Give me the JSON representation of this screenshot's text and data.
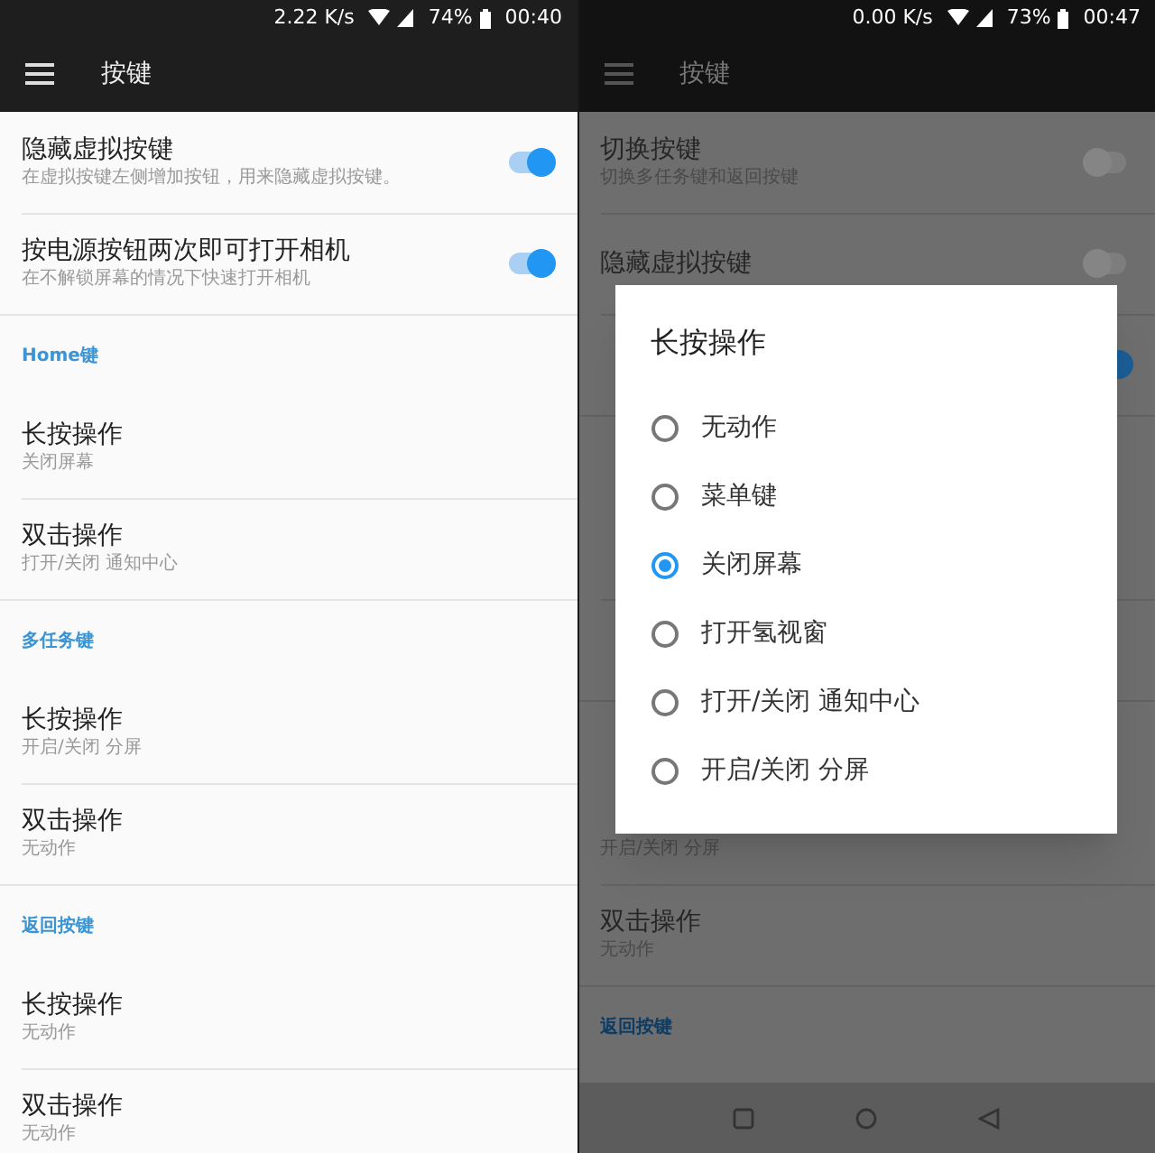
{
  "panels": [
    {
      "dimmed": false,
      "status_bar": {
        "speed": "2.22 K/s",
        "battery": "74%",
        "time": "00:40"
      },
      "app_bar": {
        "title": "按键"
      },
      "items": [
        {
          "kind": "setting",
          "title": "隐藏虚拟按键",
          "subtitle": "在虚拟按键左侧增加按钮，用来隐藏虚拟按键。",
          "toggle": {
            "on": true
          }
        },
        {
          "kind": "setting",
          "title": "按电源按钮两次即可打开相机",
          "subtitle": "在不解锁屏幕的情况下快速打开相机",
          "toggle": {
            "on": true
          }
        },
        {
          "kind": "section",
          "label": "Home键"
        },
        {
          "kind": "setting",
          "title": "长按操作",
          "subtitle": "关闭屏幕"
        },
        {
          "kind": "setting",
          "title": "双击操作",
          "subtitle": "打开/关闭 通知中心"
        },
        {
          "kind": "section",
          "label": "多任务键"
        },
        {
          "kind": "setting",
          "title": "长按操作",
          "subtitle": "开启/关闭 分屏"
        },
        {
          "kind": "setting",
          "title": "双击操作",
          "subtitle": "无动作"
        },
        {
          "kind": "section",
          "label": "返回按键"
        },
        {
          "kind": "setting",
          "title": "长按操作",
          "subtitle": "无动作"
        },
        {
          "kind": "setting",
          "title": "双击操作",
          "subtitle": "无动作"
        }
      ],
      "nav_bar": false
    },
    {
      "dimmed": true,
      "status_bar": {
        "speed": "0.00 K/s",
        "battery": "73%",
        "time": "00:47"
      },
      "app_bar": {
        "title": "按键"
      },
      "items": [
        {
          "kind": "setting",
          "title": "切换按键",
          "subtitle": "切换多任务键和返回按键",
          "toggle": {
            "on": false
          }
        },
        {
          "kind": "setting",
          "title": "隐藏虚拟按键",
          "toggle": {
            "on": false
          }
        },
        {
          "kind": "setting",
          "toggle": {
            "on": true
          }
        },
        {
          "kind": "section"
        },
        {
          "kind": "setting"
        },
        {
          "kind": "setting"
        },
        {
          "kind": "section"
        },
        {
          "kind": "setting",
          "subtitle": "开启/关闭 分屏"
        },
        {
          "kind": "setting",
          "title": "双击操作",
          "subtitle": "无动作"
        },
        {
          "kind": "section",
          "label": "返回按键"
        }
      ],
      "nav_bar": true,
      "dialog": {
        "title": "长按操作",
        "options": [
          {
            "label": "无动作",
            "selected": false
          },
          {
            "label": "菜单键",
            "selected": false
          },
          {
            "label": "关闭屏幕",
            "selected": true
          },
          {
            "label": "打开氢视窗",
            "selected": false
          },
          {
            "label": "打开/关闭 通知中心",
            "selected": false
          },
          {
            "label": "开启/关闭 分屏",
            "selected": false
          }
        ]
      }
    }
  ]
}
